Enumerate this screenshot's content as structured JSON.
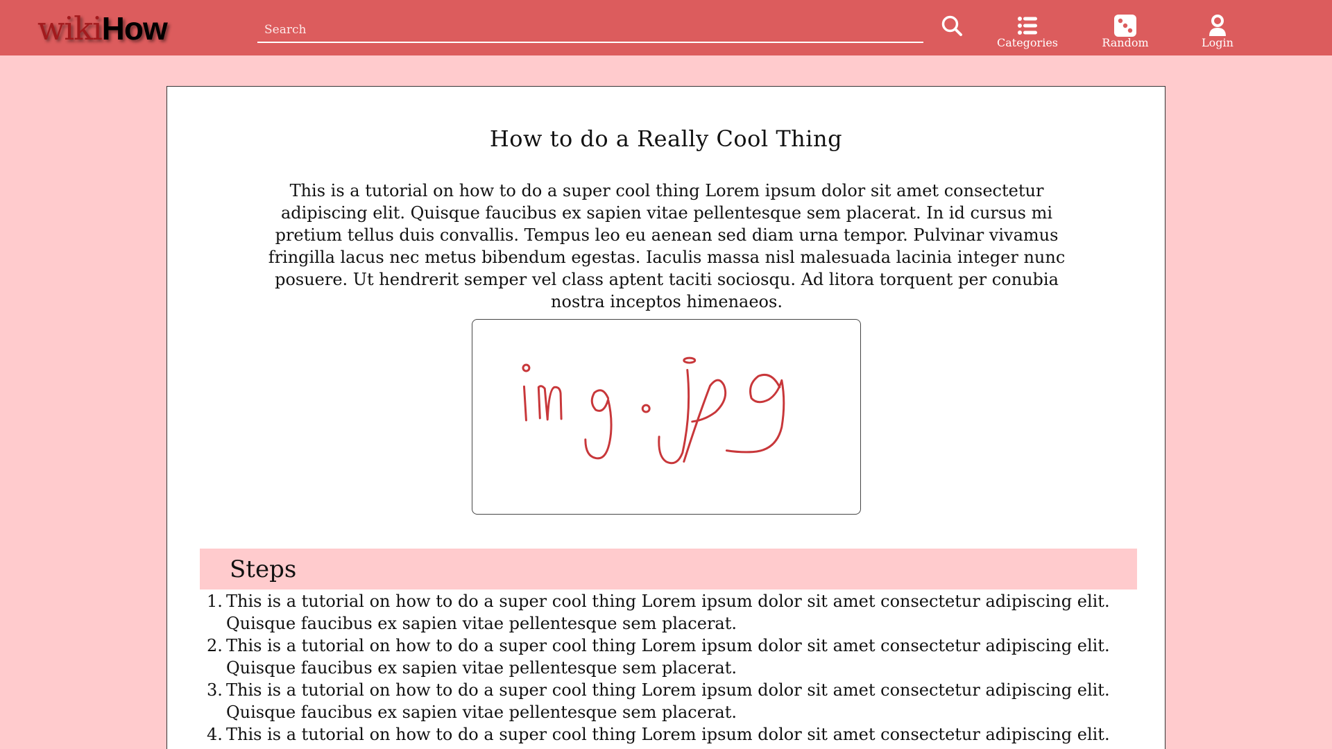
{
  "header": {
    "logo": {
      "wiki": "wiki",
      "how": "How"
    },
    "search": {
      "placeholder": "Search",
      "value": ""
    },
    "nav": [
      {
        "label": "Categories",
        "icon": "list-icon"
      },
      {
        "label": "Random",
        "icon": "dice-icon"
      },
      {
        "label": "Login",
        "icon": "user-icon"
      }
    ]
  },
  "article": {
    "title": "How to do a Really Cool Thing",
    "intro": "This is a tutorial on how to do a super cool thing Lorem ipsum dolor sit amet consectetur adipiscing elit. Quisque faucibus ex sapien vitae pellentesque sem placerat. In id cursus mi pretium tellus duis convallis. Tempus leo eu aenean sed diam urna tempor. Pulvinar vivamus fringilla lacus nec metus bibendum egestas. Iaculis massa nisl malesuada lacinia integer nunc posuere. Ut hendrerit semper vel class aptent taciti sociosqu. Ad litora torquent per conubia nostra inceptos himenaeos.",
    "image_label": "img.jpg",
    "steps_heading": "Steps",
    "steps": [
      {
        "num": "1.",
        "text": "This is a tutorial on how to do a super cool thing Lorem ipsum dolor sit amet consectetur adipiscing elit. Quisque faucibus ex sapien vitae pellentesque sem placerat."
      },
      {
        "num": "2.",
        "text": "This is a tutorial on how to do a super cool thing Lorem ipsum dolor sit amet consectetur adipiscing elit. Quisque faucibus ex sapien vitae pellentesque sem placerat."
      },
      {
        "num": "3.",
        "text": "This is a tutorial on how to do a super cool thing Lorem ipsum dolor sit amet consectetur adipiscing elit. Quisque faucibus ex sapien vitae pellentesque sem placerat."
      },
      {
        "num": "4.",
        "text": "This is a tutorial on how to do a super cool thing Lorem ipsum dolor sit amet consectetur adipiscing elit. Quisque"
      }
    ]
  },
  "colors": {
    "header_bg": "#dc5c5d",
    "page_bg": "#ffcbcd",
    "logo_wiki": "#a31a1d",
    "sketch_stroke": "#c8373a"
  }
}
